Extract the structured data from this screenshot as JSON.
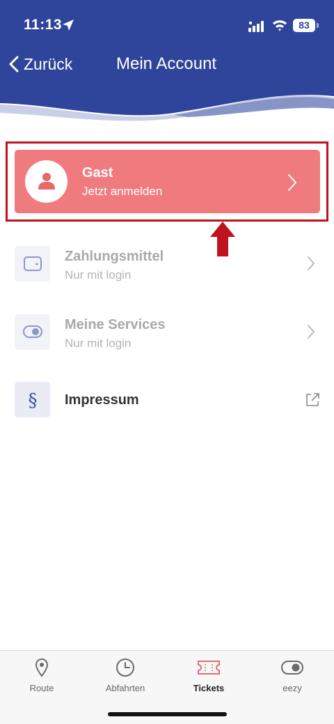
{
  "status_bar": {
    "time": "11:13",
    "battery": "83"
  },
  "nav": {
    "back_label": "Zurück",
    "title": "Mein Account"
  },
  "guest": {
    "name": "Gast",
    "subtitle": "Jetzt anmelden"
  },
  "menu": [
    {
      "title": "Zahlungsmittel",
      "subtitle": "Nur mit login",
      "icon": "wallet-icon",
      "enabled": false
    },
    {
      "title": "Meine Services",
      "subtitle": "Nur mit login",
      "icon": "toggle-icon",
      "enabled": false
    },
    {
      "title": "Impressum",
      "icon": "section-sign-icon",
      "enabled": true
    }
  ],
  "tabbar": {
    "tabs": [
      {
        "label": "Route",
        "icon": "location-pin-icon"
      },
      {
        "label": "Abfahrten",
        "icon": "clock-icon"
      },
      {
        "label": "Tickets",
        "icon": "ticket-icon",
        "active": true
      },
      {
        "label": "eezy",
        "icon": "toggle-icon"
      }
    ]
  },
  "colors": {
    "primary": "#2f459b",
    "guest_card": "#f07b7e",
    "highlight": "#c0111f",
    "tickets_accent": "#e56b6f"
  }
}
